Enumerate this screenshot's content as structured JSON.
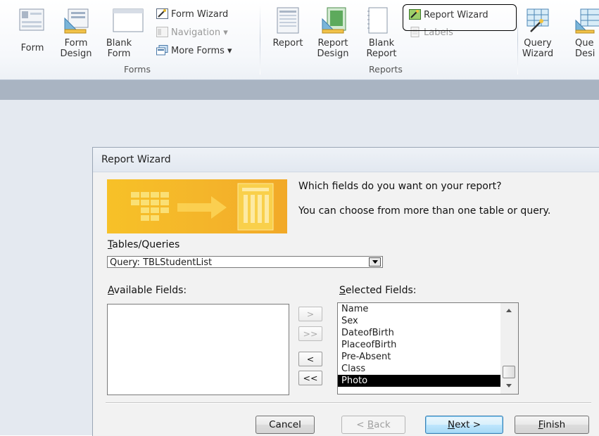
{
  "ribbon": {
    "forms_group": {
      "label": "Forms",
      "form": {
        "label": "Form",
        "icon": "form-icon"
      },
      "form_design": {
        "label": "Form\nDesign",
        "icon": "form-design-icon"
      },
      "blank_form": {
        "label": "Blank\nForm",
        "icon": "blank-form-icon"
      },
      "form_wizard": {
        "label": "Form Wizard",
        "icon": "form-wizard-icon"
      },
      "navigation": {
        "label": "Navigation ▾",
        "icon": "navigation-icon"
      },
      "more_forms": {
        "label": "More Forms ▾",
        "icon": "more-forms-icon"
      }
    },
    "reports_group": {
      "label": "Reports",
      "report": {
        "label": "Report",
        "icon": "report-icon"
      },
      "report_design": {
        "label": "Report\nDesign",
        "icon": "report-design-icon"
      },
      "blank_report": {
        "label": "Blank\nReport",
        "icon": "blank-report-icon"
      },
      "report_wizard": {
        "label": "Report Wizard",
        "icon": "report-wizard-icon"
      },
      "labels": {
        "label": "Labels",
        "icon": "labels-icon"
      }
    },
    "queries_group": {
      "query_wizard": {
        "label": "Query\nWizard",
        "icon": "query-wizard-icon"
      },
      "query_design": {
        "label": "Que\nDesi",
        "icon": "query-design-icon"
      }
    }
  },
  "dialog": {
    "title": "Report Wizard",
    "question": "Which fields do you want on your report?",
    "hint": "You can choose from more than one table or query.",
    "tables_label": "Tables/Queries",
    "tables_label_accel": "T",
    "tables_label_rest": "ables/Queries",
    "query_value": "Query: TBLStudentList",
    "available_label_accel": "A",
    "available_label_rest": "vailable Fields:",
    "selected_label_accel": "S",
    "selected_label_rest": "elected Fields:",
    "available_fields": [],
    "selected_fields": [
      "Name",
      "Sex",
      "DateofBirth",
      "PlaceofBirth",
      "Pre-Absent",
      "Class",
      "Photo"
    ],
    "selected_highlight": "Photo",
    "move_buttons": [
      ">",
      ">>",
      "<",
      "<<"
    ],
    "buttons": {
      "cancel": "Cancel",
      "back_pre": "< ",
      "back_accel": "B",
      "back_rest": "ack",
      "next_accel": "N",
      "next_rest": "ext >",
      "finish_accel": "F",
      "finish_rest": "inish"
    }
  },
  "colors": {
    "banner": "#f4b52a",
    "workspace": "#e4e9f0",
    "dark_bar": "#a9b4c2",
    "selection": "#000000"
  }
}
